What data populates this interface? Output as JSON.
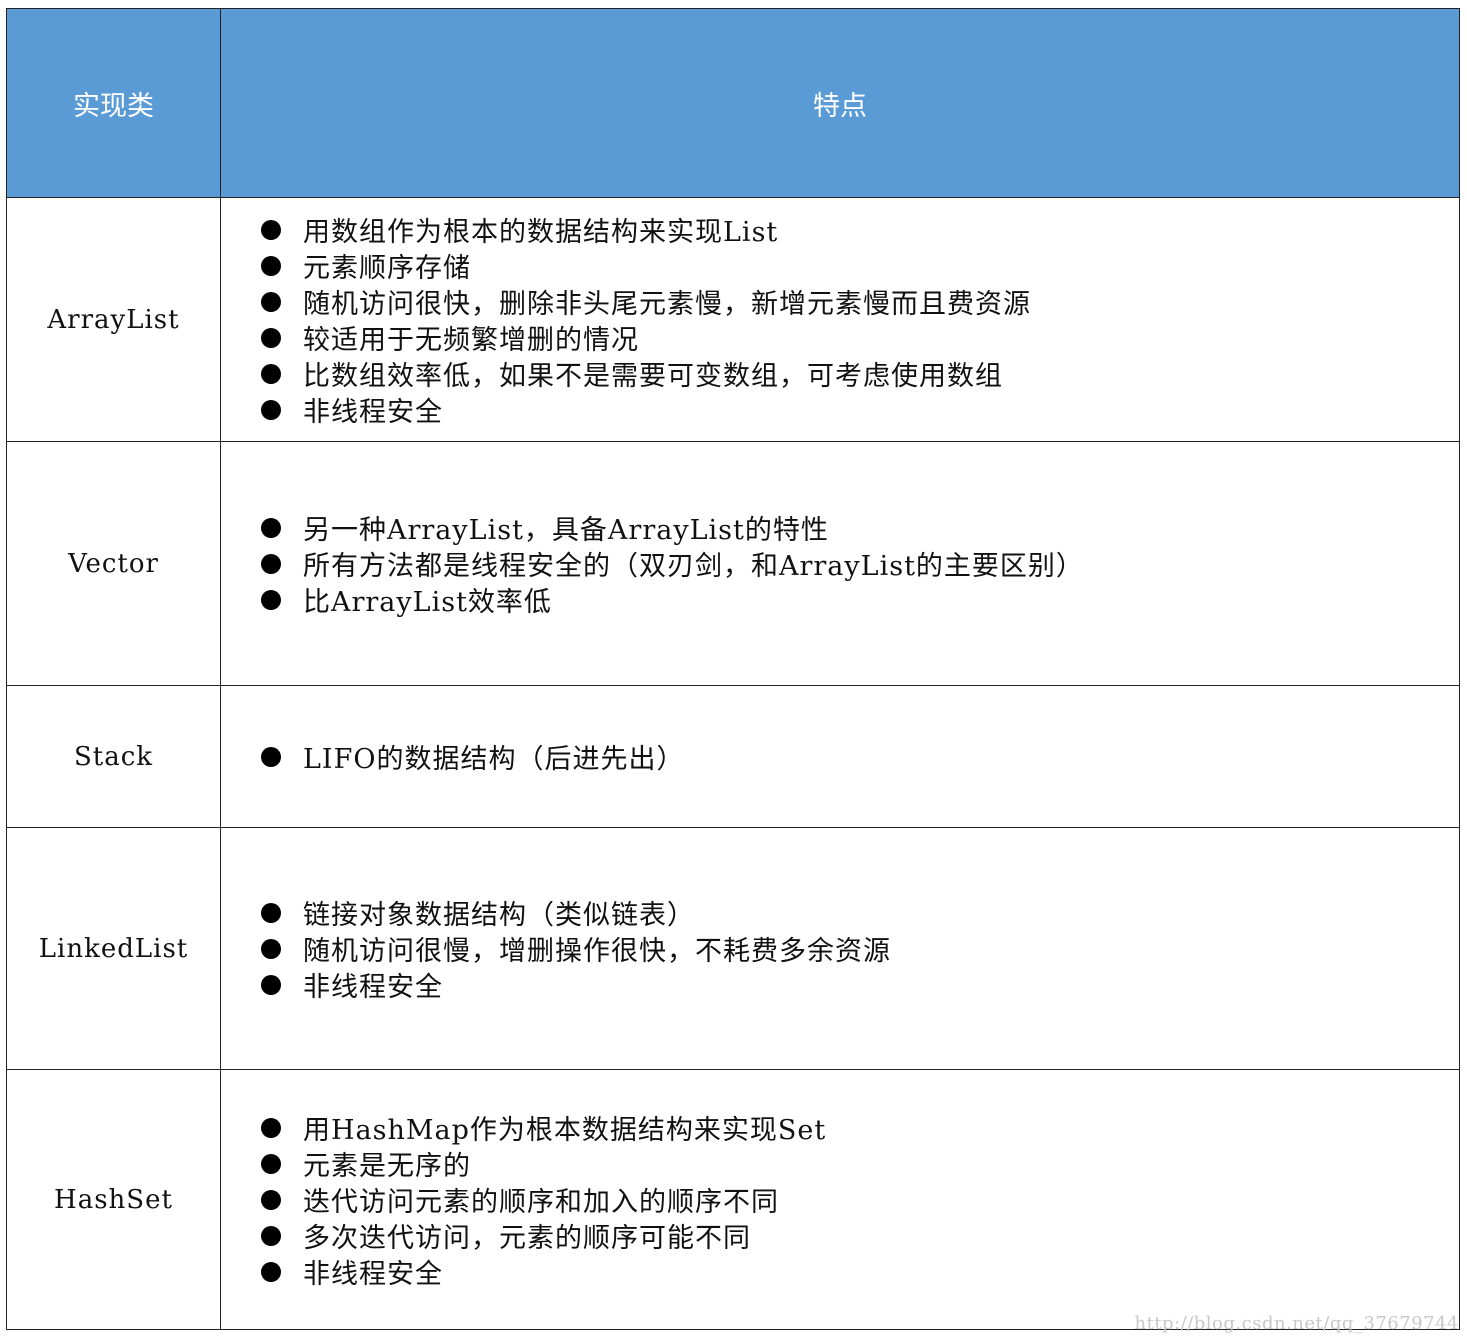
{
  "table": {
    "headers": {
      "class": "实现类",
      "features": "特点"
    },
    "rows": [
      {
        "name": "ArrayList",
        "features": [
          "用数组作为根本的数据结构来实现List",
          "元素顺序存储",
          "随机访问很快，删除非头尾元素慢，新增元素慢而且费资源",
          "较适用于无频繁增删的情况",
          "比数组效率低，如果不是需要可变数组，可考虑使用数组",
          "非线程安全"
        ]
      },
      {
        "name": "Vector",
        "features": [
          "另一种ArrayList，具备ArrayList的特性",
          "所有方法都是线程安全的（双刃剑，和ArrayList的主要区别）",
          "比ArrayList效率低"
        ]
      },
      {
        "name": "Stack",
        "features": [
          "LIFO的数据结构（后进先出）"
        ]
      },
      {
        "name": "LinkedList",
        "features": [
          "链接对象数据结构（类似链表）",
          "随机访问很慢，增删操作很快，不耗费多余资源",
          "非线程安全"
        ]
      },
      {
        "name": "HashSet",
        "features": [
          "用HashMap作为根本数据结构来实现Set",
          "元素是无序的",
          "迭代访问元素的顺序和加入的顺序不同",
          "多次迭代访问，元素的顺序可能不同",
          "非线程安全"
        ]
      }
    ]
  },
  "watermark": "http://blog.csdn.net/qq_37679744",
  "colors": {
    "header_bg": "#5b9bd5",
    "header_text": "#ffffff",
    "border": "#222222"
  }
}
